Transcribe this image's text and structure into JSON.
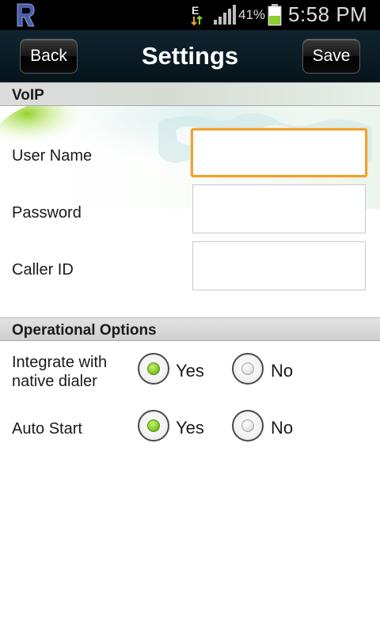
{
  "status_bar": {
    "network_type": "E",
    "battery_percent": "41%",
    "time": "5:58 PM",
    "icons": [
      "app-logo-icon",
      "data-transfer-icon",
      "signal-icon",
      "battery-icon"
    ]
  },
  "title_bar": {
    "title": "Settings",
    "back_label": "Back",
    "save_label": "Save"
  },
  "voip": {
    "header": "VoIP",
    "fields": [
      {
        "label": "User Name",
        "value": "",
        "focused": true
      },
      {
        "label": "Password",
        "value": ""
      },
      {
        "label": "Caller ID",
        "value": ""
      }
    ]
  },
  "operational": {
    "header": "Operational Options",
    "options": [
      {
        "label_line1": "Integrate with",
        "label_line2": "native dialer",
        "yes_label": "Yes",
        "no_label": "No",
        "selected": "Yes"
      },
      {
        "label_line1": "Auto Start",
        "label_line2": "",
        "yes_label": "Yes",
        "no_label": "No",
        "selected": "Yes"
      }
    ]
  },
  "colors": {
    "title_bar": "#0a1c26",
    "focus_border": "#f0a22c",
    "radio_selected": "#86cc28",
    "section_header": "#d6d6d6"
  }
}
